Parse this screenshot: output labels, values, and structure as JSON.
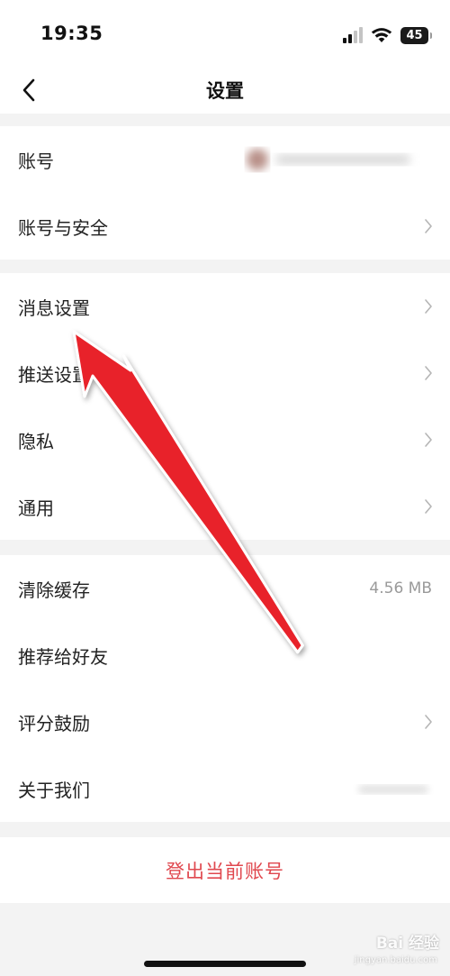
{
  "status_bar": {
    "time": "19:35",
    "battery": "45",
    "icons": [
      "signal-icon",
      "wifi-icon",
      "battery-icon"
    ]
  },
  "nav": {
    "title": "设置",
    "back_icon": "chevron-left-icon"
  },
  "groups": {
    "account": {
      "account_label": "账号",
      "security_label": "账号与安全"
    },
    "preferences": {
      "message_label": "消息设置",
      "push_label": "推送设置",
      "privacy_label": "隐私",
      "general_label": "通用"
    },
    "misc": {
      "cache_label": "清除缓存",
      "cache_value": "4.56 MB",
      "recommend_label": "推荐给好友",
      "rate_label": "评分鼓励",
      "about_label": "关于我们"
    }
  },
  "logout": {
    "label": "登出当前账号"
  },
  "colors": {
    "logout": "#e0484f",
    "arrow": "#e8242b",
    "background": "#f3f3f3"
  },
  "watermark": {
    "brand": "Bai 经验",
    "url": "jingyan.baidu.com"
  }
}
